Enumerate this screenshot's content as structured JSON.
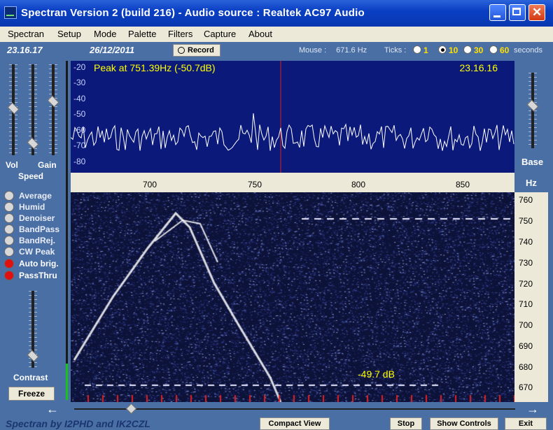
{
  "window": {
    "title": "Spectran Version 2 (build 216) - Audio source  :  Realtek AC97 Audio"
  },
  "menu": [
    "Spectran",
    "Setup",
    "Mode",
    "Palette",
    "Filters",
    "Capture",
    "About"
  ],
  "status": {
    "time": "23.16.17",
    "date": "26/12/2011",
    "record_label": "Record",
    "mouse_label": "Mouse :",
    "mouse_value": "671.6 Hz",
    "ticks_label": "Ticks :",
    "tick_options": [
      "1",
      "10",
      "30",
      "60"
    ],
    "tick_selected": "10",
    "seconds_label": "seconds"
  },
  "left_panel": {
    "vol_label": "Vol",
    "gain_label": "Gain",
    "speed_label": "Speed",
    "options": [
      {
        "label": "Average",
        "on": false
      },
      {
        "label": "Humid",
        "on": false
      },
      {
        "label": "Denoiser",
        "on": false
      },
      {
        "label": "BandPass",
        "on": false
      },
      {
        "label": "BandRej.",
        "on": false
      },
      {
        "label": "CW Peak",
        "on": false
      },
      {
        "label": "Auto brig.",
        "on": true
      },
      {
        "label": "PassThru",
        "on": true
      }
    ],
    "contrast_label": "Contrast",
    "freeze_label": "Freeze"
  },
  "spectrum": {
    "peak_text": "Peak at  751.39Hz (-50.7dB)",
    "time_text": "23.16.16",
    "y_ticks": [
      "-20",
      "-30",
      "-40",
      "-50",
      "-60",
      "-70",
      "-80"
    ],
    "x_ticks": [
      "700",
      "750",
      "800",
      "850"
    ]
  },
  "waterfall": {
    "db_text": "-49.7 dB",
    "y_ticks": [
      "760",
      "750",
      "740",
      "730",
      "720",
      "710",
      "700",
      "690",
      "680",
      "670"
    ]
  },
  "right_panel": {
    "base_label": "Base",
    "hz_label": "Hz"
  },
  "bottom": {
    "footer_text": "Spectran  by I2PHD and IK2CZL",
    "buttons": [
      "Compact View",
      "Stop",
      "Show Controls",
      "Exit"
    ]
  },
  "colors": {
    "spectrum_bg": "#0b1a7a",
    "peak_text": "#ffff00",
    "waterfall_bg": "#0d1238"
  }
}
